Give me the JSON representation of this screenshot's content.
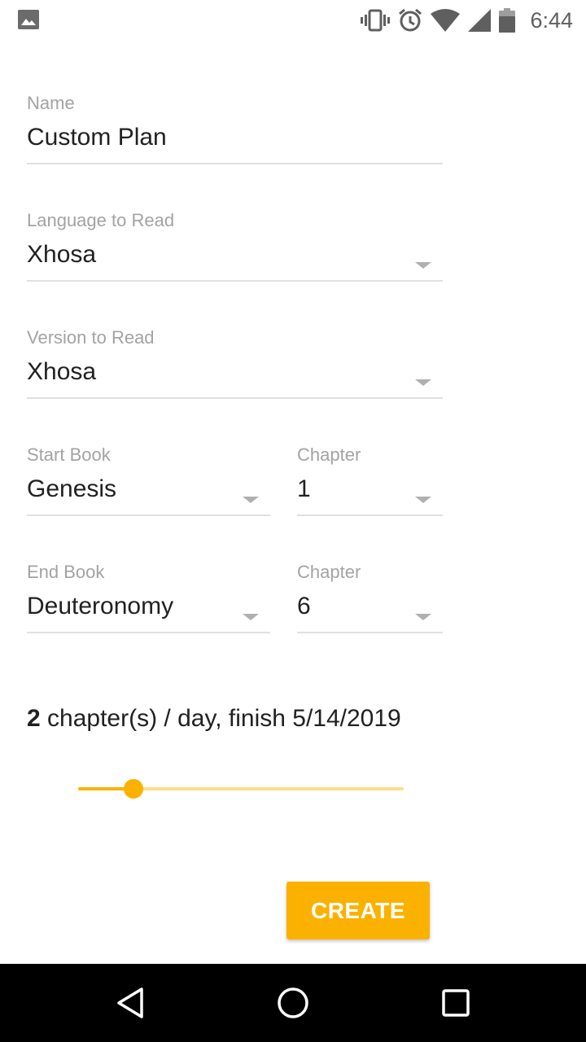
{
  "status_bar": {
    "time": "6:44",
    "icons": [
      "image-icon",
      "vibrate-icon",
      "alarm-icon",
      "wifi-icon",
      "signal-icon",
      "battery-icon"
    ]
  },
  "form": {
    "name": {
      "label": "Name",
      "value": "Custom Plan"
    },
    "language": {
      "label": "Language to Read",
      "value": "Xhosa"
    },
    "version": {
      "label": "Version to Read",
      "value": "Xhosa"
    },
    "start_book": {
      "label": "Start Book",
      "value": "Genesis"
    },
    "start_chapter": {
      "label": "Chapter",
      "value": "1"
    },
    "end_book": {
      "label": "End Book",
      "value": "Deuteronomy"
    },
    "end_chapter": {
      "label": "Chapter",
      "value": "6"
    }
  },
  "summary": {
    "chapters_per_day": "2",
    "text": " chapter(s) / day, finish 5/14/2019"
  },
  "slider": {
    "value_fraction": 0.17,
    "track_color": "#fbe08a",
    "fill_color": "#fbb100"
  },
  "actions": {
    "create_label": "CREATE",
    "accent_color": "#fbb100"
  },
  "nav_bar": {
    "icons": [
      "back-icon",
      "home-icon",
      "recents-icon"
    ]
  }
}
